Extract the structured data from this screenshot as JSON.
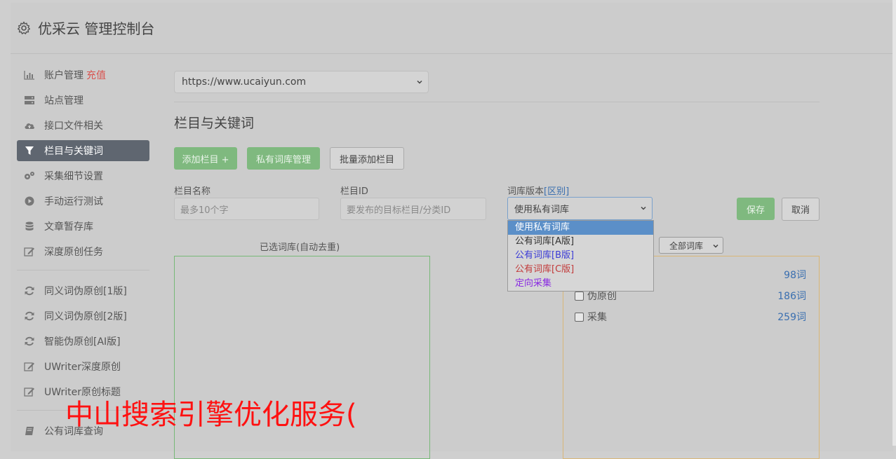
{
  "app": {
    "title": "优采云 管理控制台"
  },
  "sidebar": {
    "items": [
      {
        "label": "账户管理",
        "accent": "充值",
        "icon": "bar-chart-icon"
      },
      {
        "label": "站点管理",
        "icon": "server-icon"
      },
      {
        "label": "接口文件相关",
        "icon": "cloud-upload-icon"
      },
      {
        "label": "栏目与关键词",
        "icon": "filter-icon",
        "active": true
      },
      {
        "label": "采集细节设置",
        "icon": "gears-icon"
      },
      {
        "label": "手动运行测试",
        "icon": "play-circle-icon"
      },
      {
        "label": "文章暂存库",
        "icon": "database-icon"
      },
      {
        "label": "深度原创任务",
        "icon": "edit-icon"
      }
    ],
    "items2": [
      {
        "label": "同义词伪原创[1版]",
        "icon": "refresh-icon"
      },
      {
        "label": "同义词伪原创[2版]",
        "icon": "refresh-icon"
      },
      {
        "label": "智能伪原创[AI版]",
        "icon": "refresh-icon"
      },
      {
        "label": "UWriter深度原创",
        "icon": "edit-icon"
      },
      {
        "label": "UWriter原创标题",
        "icon": "edit-icon"
      }
    ],
    "items3": [
      {
        "label": "公有词库查询",
        "icon": "book-icon"
      }
    ]
  },
  "main": {
    "site_select": "https://www.ucaiyun.com",
    "section_title": "栏目与关键词",
    "buttons": {
      "add": "添加栏目 +",
      "private": "私有词库管理",
      "batch": "批量添加栏目",
      "save": "保存",
      "cancel": "取消"
    },
    "form": {
      "name_label": "栏目名称",
      "name_placeholder": "最多10个字",
      "id_label": "栏目ID",
      "id_placeholder": "要发布的目标栏目/分类ID",
      "version_label": "词库版本",
      "version_link": "[区别]",
      "version_value": "使用私有词库"
    },
    "dropdown": [
      {
        "label": "使用私有词库",
        "color": "#ffffff"
      },
      {
        "label": "公有词库[A版]",
        "color": "#333333"
      },
      {
        "label": "公有词库[B版]",
        "color": "#3b3bd6"
      },
      {
        "label": "公有词库[C版]",
        "color": "#c23b3b"
      },
      {
        "label": "定向采集",
        "color": "#8a2be2"
      }
    ],
    "selected_label": "已选词库(自动去重)",
    "filter_select": "全部词库",
    "library_rows": [
      {
        "label": "",
        "count": "98词"
      },
      {
        "label": "伪原创",
        "count": "186词"
      },
      {
        "label": "采集",
        "count": "259词"
      }
    ]
  },
  "watermark": "中山搜索引擎优化服务("
}
